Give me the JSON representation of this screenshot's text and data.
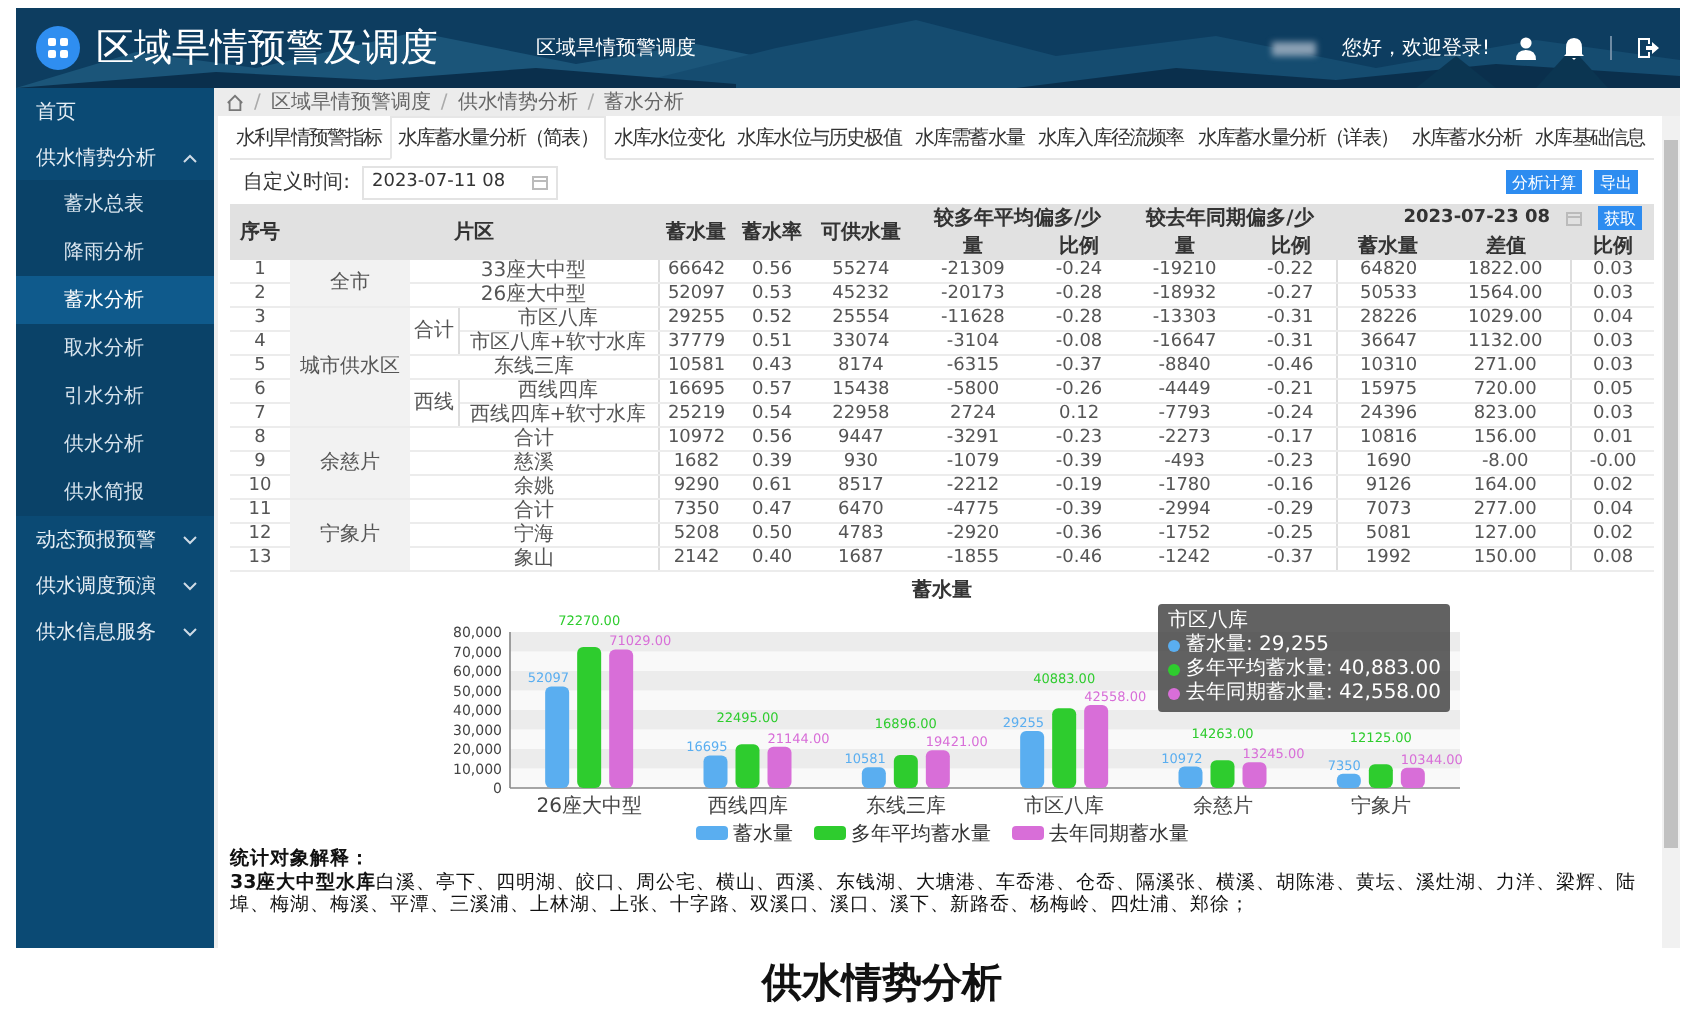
{
  "header": {
    "title": "区域旱情预警及调度",
    "subtitle": "区域旱情预警调度",
    "greeting": "您好，欢迎登录!"
  },
  "sidebar": {
    "items": [
      {
        "label": "首页",
        "kind": "link"
      },
      {
        "label": "供水情势分析",
        "kind": "group",
        "expanded": true,
        "children": [
          {
            "label": "蓄水总表",
            "selected": false
          },
          {
            "label": "降雨分析",
            "selected": false
          },
          {
            "label": "蓄水分析",
            "selected": true
          },
          {
            "label": "取水分析",
            "selected": false
          },
          {
            "label": "引水分析",
            "selected": false
          },
          {
            "label": "供水分析",
            "selected": false
          },
          {
            "label": "供水简报",
            "selected": false
          }
        ]
      },
      {
        "label": "动态预报预警",
        "kind": "group",
        "expanded": false
      },
      {
        "label": "供水调度预演",
        "kind": "group",
        "expanded": false
      },
      {
        "label": "供水信息服务",
        "kind": "group",
        "expanded": false
      }
    ]
  },
  "breadcrumb": [
    {
      "kind": "separator",
      "text": "/"
    },
    {
      "kind": "link",
      "text": "区域旱情预警调度"
    },
    {
      "kind": "separator",
      "text": "/"
    },
    {
      "kind": "link",
      "text": "供水情势分析"
    },
    {
      "kind": "separator",
      "text": "/"
    },
    {
      "kind": "link",
      "text": "蓄水分析"
    }
  ],
  "tabs": [
    {
      "label": "水利旱情预警指标",
      "selected": false
    },
    {
      "label": "水库蓄水量分析（简表）",
      "selected": true
    },
    {
      "label": "水库水位变化",
      "selected": false
    },
    {
      "label": "水库水位与历史极值",
      "selected": false
    },
    {
      "label": "水库需蓄水量",
      "selected": false
    },
    {
      "label": "水库入库径流频率",
      "selected": false
    },
    {
      "label": "水库蓄水量分析（详表）",
      "selected": false
    },
    {
      "label": "水库蓄水分析",
      "selected": false
    },
    {
      "label": "水库基础信息",
      "selected": false
    }
  ],
  "filter": {
    "label": "自定义时间:",
    "value": "2023-07-11 08",
    "buttons": [
      "分析计算",
      "导出"
    ]
  },
  "table": {
    "columns": [
      "序号",
      "片区",
      "蓄水量",
      "蓄水率",
      "可供水量",
      "较多年平均偏多/少",
      "较去年同期偏多/少"
    ],
    "compare_date": "2023-07-23 08",
    "compare_button": "获取",
    "subcolumns": [
      "量",
      "比例",
      "量",
      "比例",
      "蓄水量",
      "差值",
      "比例"
    ],
    "sections": [
      {
        "area": "全市",
        "groups": [
          {
            "rows": [
              {
                "no": "1",
                "name": "33座大中型",
                "storage": "66642",
                "rate": "0.56",
                "supply": "55274",
                "avg_diff": "-21309",
                "avg_ratio": "-0.24",
                "last_diff": "-19210",
                "last_ratio": "-0.22",
                "cmp_storage": "64820",
                "cmp_diff": "1822.00",
                "cmp_ratio": "0.03"
              },
              {
                "no": "2",
                "name": "26座大中型",
                "storage": "52097",
                "rate": "0.53",
                "supply": "45232",
                "avg_diff": "-20173",
                "avg_ratio": "-0.28",
                "last_diff": "-18932",
                "last_ratio": "-0.27",
                "cmp_storage": "50533",
                "cmp_diff": "1564.00",
                "cmp_ratio": "0.03"
              }
            ]
          }
        ]
      },
      {
        "area": "城市供水区",
        "groups": [
          {
            "label": "合计",
            "rows": [
              {
                "no": "3",
                "name": "市区八库",
                "storage": "29255",
                "rate": "0.52",
                "supply": "25554",
                "avg_diff": "-11628",
                "avg_ratio": "-0.28",
                "last_diff": "-13303",
                "last_ratio": "-0.31",
                "cmp_storage": "28226",
                "cmp_diff": "1029.00",
                "cmp_ratio": "0.04"
              },
              {
                "no": "4",
                "name": "市区八库+软寸水库",
                "storage": "37779",
                "rate": "0.51",
                "supply": "33074",
                "avg_diff": "-3104",
                "avg_ratio": "-0.08",
                "last_diff": "-16647",
                "last_ratio": "-0.31",
                "cmp_storage": "36647",
                "cmp_diff": "1132.00",
                "cmp_ratio": "0.03"
              }
            ]
          },
          {
            "rows": [
              {
                "no": "5",
                "name": "东线三库",
                "storage": "10581",
                "rate": "0.43",
                "supply": "8174",
                "avg_diff": "-6315",
                "avg_ratio": "-0.37",
                "last_diff": "-8840",
                "last_ratio": "-0.46",
                "cmp_storage": "10310",
                "cmp_diff": "271.00",
                "cmp_ratio": "0.03"
              }
            ]
          },
          {
            "label": "西线",
            "rows": [
              {
                "no": "6",
                "name": "西线四库",
                "storage": "16695",
                "rate": "0.57",
                "supply": "15438",
                "avg_diff": "-5800",
                "avg_ratio": "-0.26",
                "last_diff": "-4449",
                "last_ratio": "-0.21",
                "cmp_storage": "15975",
                "cmp_diff": "720.00",
                "cmp_ratio": "0.05"
              },
              {
                "no": "7",
                "name": "西线四库+软寸水库",
                "storage": "25219",
                "rate": "0.54",
                "supply": "22958",
                "avg_diff": "2724",
                "avg_ratio": "0.12",
                "last_diff": "-7793",
                "last_ratio": "-0.24",
                "cmp_storage": "24396",
                "cmp_diff": "823.00",
                "cmp_ratio": "0.03"
              }
            ]
          }
        ]
      },
      {
        "area": "余慈片",
        "groups": [
          {
            "rows": [
              {
                "no": "8",
                "name": "合计",
                "storage": "10972",
                "rate": "0.56",
                "supply": "9447",
                "avg_diff": "-3291",
                "avg_ratio": "-0.23",
                "last_diff": "-2273",
                "last_ratio": "-0.17",
                "cmp_storage": "10816",
                "cmp_diff": "156.00",
                "cmp_ratio": "0.01"
              },
              {
                "no": "9",
                "name": "慈溪",
                "storage": "1682",
                "rate": "0.39",
                "supply": "930",
                "avg_diff": "-1079",
                "avg_ratio": "-0.39",
                "last_diff": "-493",
                "last_ratio": "-0.23",
                "cmp_storage": "1690",
                "cmp_diff": "-8.00",
                "cmp_ratio": "-0.00"
              },
              {
                "no": "10",
                "name": "余姚",
                "storage": "9290",
                "rate": "0.61",
                "supply": "8517",
                "avg_diff": "-2212",
                "avg_ratio": "-0.19",
                "last_diff": "-1780",
                "last_ratio": "-0.16",
                "cmp_storage": "9126",
                "cmp_diff": "164.00",
                "cmp_ratio": "0.02"
              }
            ]
          }
        ]
      },
      {
        "area": "宁象片",
        "groups": [
          {
            "rows": [
              {
                "no": "11",
                "name": "合计",
                "storage": "7350",
                "rate": "0.47",
                "supply": "6470",
                "avg_diff": "-4775",
                "avg_ratio": "-0.39",
                "last_diff": "-2994",
                "last_ratio": "-0.29",
                "cmp_storage": "7073",
                "cmp_diff": "277.00",
                "cmp_ratio": "0.04"
              },
              {
                "no": "12",
                "name": "宁海",
                "storage": "5208",
                "rate": "0.50",
                "supply": "4783",
                "avg_diff": "-2920",
                "avg_ratio": "-0.36",
                "last_diff": "-1752",
                "last_ratio": "-0.25",
                "cmp_storage": "5081",
                "cmp_diff": "127.00",
                "cmp_ratio": "0.02"
              },
              {
                "no": "13",
                "name": "象山",
                "storage": "2142",
                "rate": "0.40",
                "supply": "1687",
                "avg_diff": "-1855",
                "avg_ratio": "-0.46",
                "last_diff": "-1242",
                "last_ratio": "-0.37",
                "cmp_storage": "1992",
                "cmp_diff": "150.00",
                "cmp_ratio": "0.08"
              }
            ]
          }
        ]
      }
    ]
  },
  "chart": {
    "chart_data": {
      "type": "bar",
      "title": "蓄水量",
      "categories": [
        "26座大中型",
        "西线四库",
        "东线三库",
        "市区八库",
        "余慈片",
        "宁象片"
      ],
      "series": [
        {
          "name": "蓄水量",
          "color": "#5aaef0",
          "values": [
            52097,
            16695,
            10581,
            29255,
            10972,
            7350
          ]
        },
        {
          "name": "多年平均蓄水量",
          "color": "#2ecc2e",
          "values": [
            72270,
            22495,
            16896,
            40883,
            14263,
            12125
          ]
        },
        {
          "name": "去年同期蓄水量",
          "color": "#d86ed8",
          "values": [
            71029,
            21144,
            19421,
            42558,
            13245,
            10344
          ]
        }
      ],
      "ylim": [
        0,
        80000
      ],
      "yticks": [
        {
          "value": 0,
          "label": "0"
        },
        {
          "value": 10000,
          "label": "10,000"
        },
        {
          "value": 20000,
          "label": "20,000"
        },
        {
          "value": 30000,
          "label": "30,000"
        },
        {
          "value": 40000,
          "label": "40,000"
        },
        {
          "value": 50000,
          "label": "50,000"
        },
        {
          "value": 60000,
          "label": "60,000"
        },
        {
          "value": 70000,
          "label": "70,000"
        },
        {
          "value": 80000,
          "label": "80,000"
        }
      ],
      "value_labels": [
        [
          "52097",
          "16695",
          "10581",
          "29255",
          "10972",
          "7350"
        ],
        [
          "72270.00",
          "22495.00",
          "16896.00",
          "40883.00",
          "14263.00",
          "12125.00"
        ],
        [
          "71029.00",
          "21144.00",
          "19421.00",
          "42558.00",
          "13245.00",
          "10344.00"
        ]
      ]
    },
    "tooltip": {
      "title": "市区八库",
      "items": [
        {
          "text": "蓄水量: 29,255",
          "color": "#5aaef0"
        },
        {
          "text": "多年平均蓄水量: 40,883.00",
          "color": "#2ecc2e"
        },
        {
          "text": "去年同期蓄水量: 42,558.00",
          "color": "#d86ed8"
        }
      ]
    }
  },
  "notes": {
    "title": "统计对象解释：",
    "text": "**33座大中型水库**白溪、亭下、四明湖、皎口、周公宅、横山、西溪、东钱湖、大塘港、车岙港、仓岙、隔溪张、横溪、胡陈港、黄坛、溪灶湖、力洋、梁辉、陆埠、梅湖、梅溪、平潭、三溪浦、上林湖、上张、十字路、双溪口、溪口、溪下、新路岙、杨梅岭、四灶浦、郑徐；"
  },
  "caption": "供水情势分析"
}
